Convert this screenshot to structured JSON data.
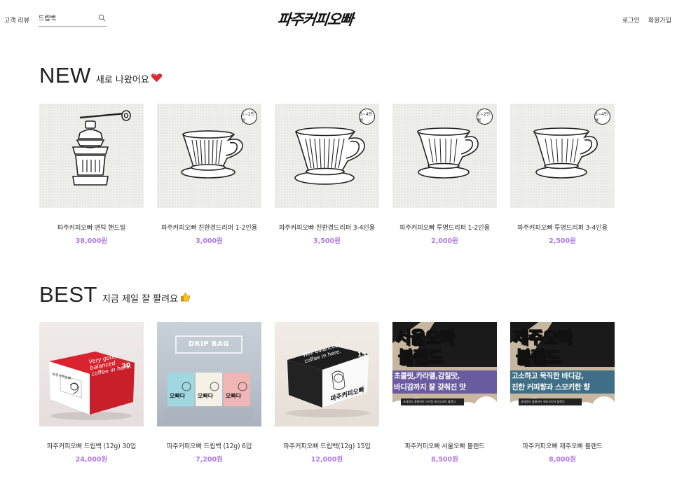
{
  "header": {
    "review_label": "고객 리뷰",
    "search_value": "드립백",
    "logo_text": "파주커피오빠",
    "login_label": "로그인",
    "signup_label": "회원가입"
  },
  "sections": {
    "new": {
      "title": "NEW",
      "subtitle": "새로 나왔어요",
      "emoji": "heart-icon",
      "products": [
        {
          "name": "파주커피오빠 앤틱 핸드밀",
          "price": "38,000원",
          "badge": "",
          "image": "hand-grinder-sticker"
        },
        {
          "name": "파주커피오빠 친환경드리퍼 1-2인용",
          "price": "3,000원",
          "badge": "1~2인용",
          "image": "dripper-sticker"
        },
        {
          "name": "파주커피오빠 친환경드리퍼 3-4인용",
          "price": "3,500원",
          "badge": "3~4인용",
          "image": "dripper-sticker"
        },
        {
          "name": "파주커피오빠 투명드리퍼 1-2인용",
          "price": "2,000원",
          "badge": "1~2인용",
          "image": "clear-dripper-sticker"
        },
        {
          "name": "파주커피오빠 투명드리퍼 3-4인용",
          "price": "2,500원",
          "badge": "3~4인용",
          "image": "clear-dripper-sticker"
        }
      ]
    },
    "best": {
      "title": "BEST",
      "subtitle": "지금 제일 잘 팔려요",
      "emoji": "thumbs-up-icon",
      "products": [
        {
          "name": "파주커피오빠 드립백 (12g) 30입",
          "price": "24,000원",
          "image": "red-box-photo",
          "box_text": "Very good balanced coffee in here.",
          "box_count": "30",
          "box_brand": "파주커피오빠"
        },
        {
          "name": "파주커피오빠 드립백 (12g) 6입",
          "price": "7,200원",
          "image": "drip-bag-photo",
          "sign_text": "DRIP BAG",
          "bag_brand": "오빠다"
        },
        {
          "name": "파주커피오빠 드립백(12g) 15입",
          "price": "12,000원",
          "image": "black-box-photo",
          "box_text": "Well balanced coffee in here.",
          "box_count": "15",
          "box_brand": "파주커피오빠"
        },
        {
          "name": "파주커피오빠 서울오빠 블렌드",
          "price": "8,500원",
          "image": "seoul-blend-poster",
          "title1": "서울오빠",
          "title2": "블렌드",
          "band1": "초콜릿,카라멜,감칠맛,",
          "band2": "바디감까지 잘 갖춰진 맛",
          "band_color": "#6a5aa0",
          "note": "과테말라 콜롬비아 브라질 에티오피아 블렌딩"
        },
        {
          "name": "파주커피오빠 제주오빠 블렌드",
          "price": "8,000원",
          "image": "jeju-blend-poster",
          "title1": "제주오빠",
          "title2": "블렌드",
          "band1": "고소하고 묵직한 바디감,",
          "band2": "진한 커피향과 스모키한 향",
          "band_color": "#3f6e86",
          "note": "과테말라 콜롬비아 에티오피아 블렌딩"
        }
      ]
    }
  },
  "colors": {
    "price": "#b07ae6"
  }
}
